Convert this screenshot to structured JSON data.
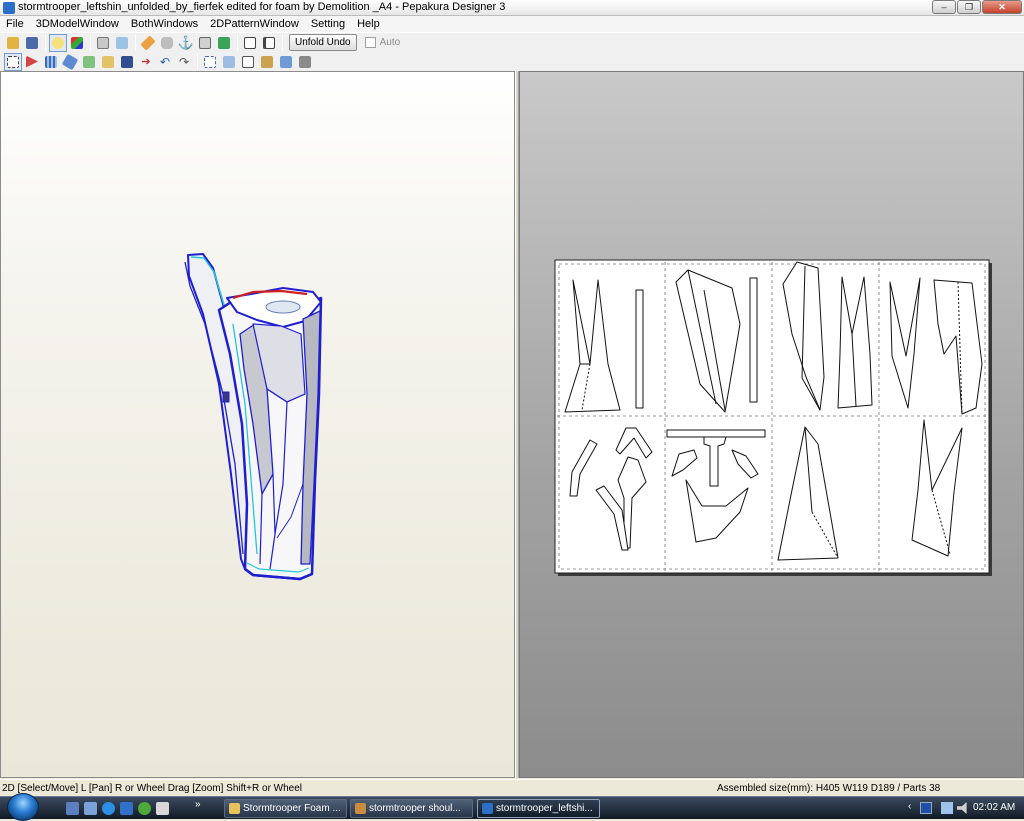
{
  "window": {
    "title": "stormtrooper_leftshin_unfolded_by_fierfek edited for foam by Demolition _A4 - Pepakura Designer 3",
    "minimize_label": "–",
    "maximize_label": "❐",
    "close_label": "✕"
  },
  "menu": {
    "items": [
      "File",
      "3DModelWindow",
      "BothWindows",
      "2DPatternWindow",
      "Setting",
      "Help"
    ]
  },
  "toolbar": {
    "unfold_undo_label": "Unfold Undo",
    "auto_label": "Auto",
    "auto_checked": false
  },
  "status": {
    "mode_text": "2D [Select/Move] L [Pan] R or Wheel Drag [Zoom] Shift+R or Wheel",
    "assembled_text": "Assembled size(mm): H405 W119 D189 / Parts 38"
  },
  "taskbar": {
    "chevron": "»",
    "buttons": [
      {
        "label": "Stormtrooper Foam ...",
        "active": false
      },
      {
        "label": "stormtrooper shoul...",
        "active": false
      },
      {
        "label": "stormtrooper_leftshi...",
        "active": true
      }
    ],
    "clock": "02:02 AM"
  },
  "colors": {
    "model_outline": "#1f1fd0",
    "model_highlight": "#24c7d6",
    "model_cut_edge": "#d01f1f",
    "left_pane_top": "#ffffff",
    "left_pane_bottom": "#e9e7d8",
    "right_pane_top": "#c9c9c9",
    "right_pane_bottom": "#8c8c8c"
  }
}
